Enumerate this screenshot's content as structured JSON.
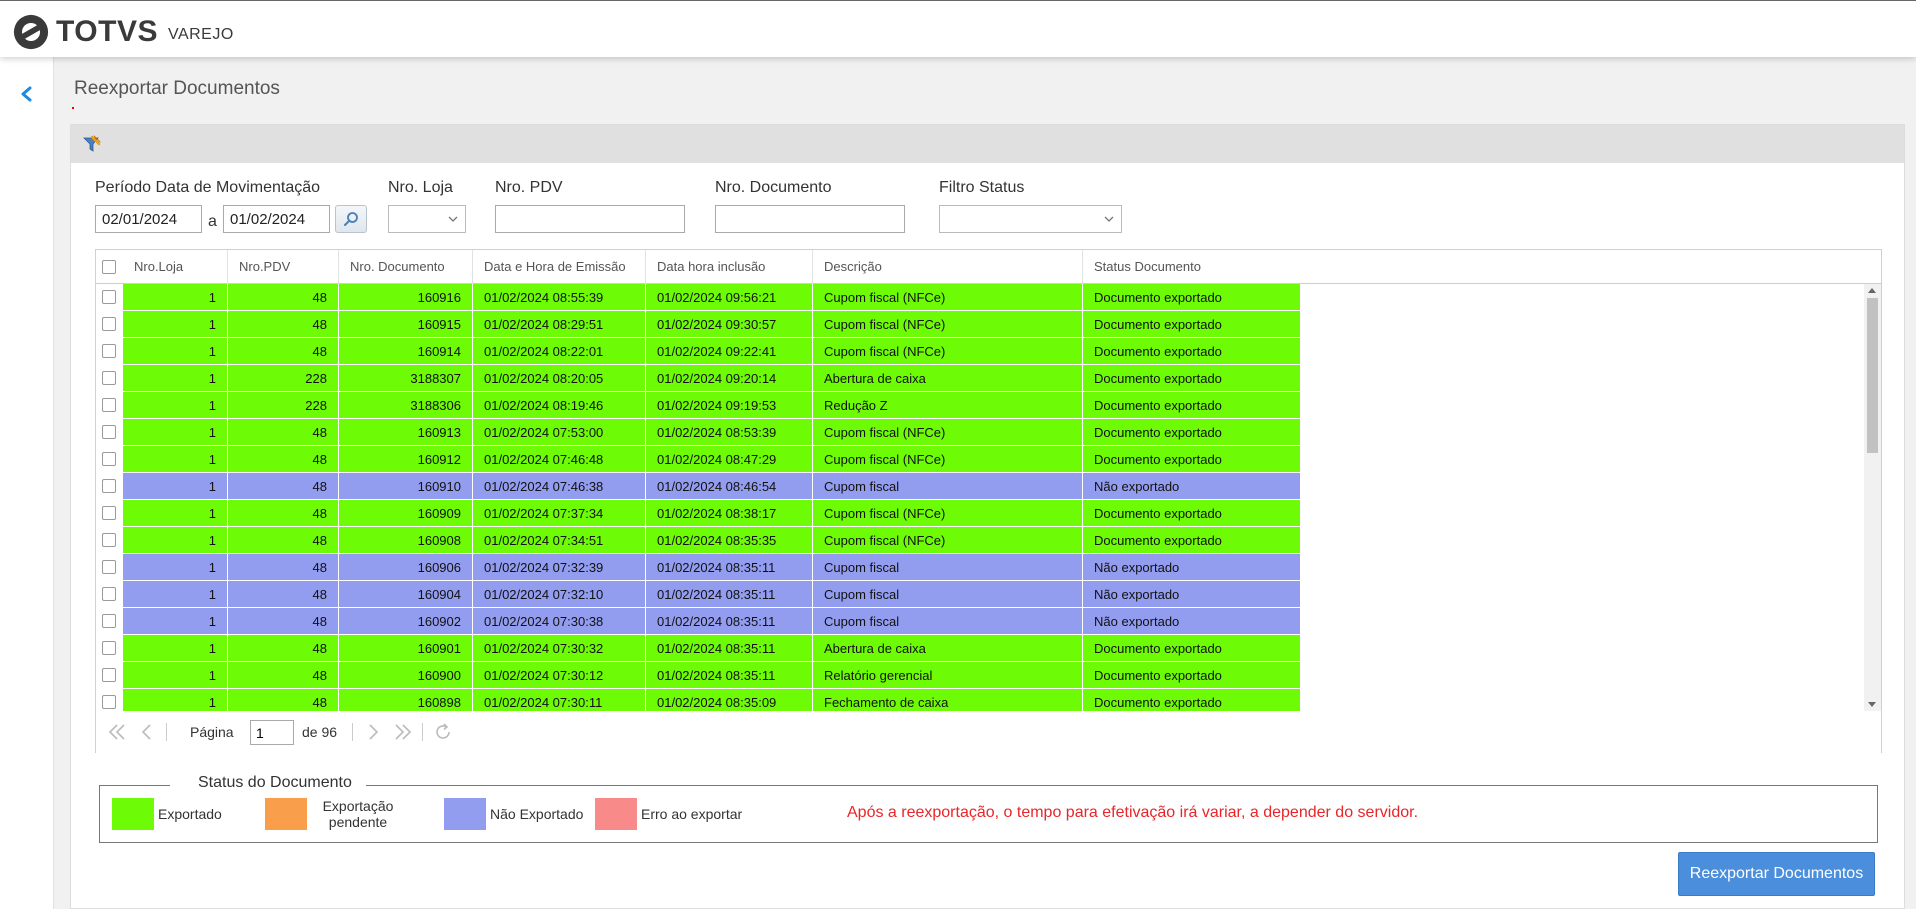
{
  "app": {
    "brand": "TOTVS",
    "subbrand": "VAREJO"
  },
  "page": {
    "title": "Reexportar Documentos"
  },
  "filters": {
    "periodo_label": "Período Data de Movimentação",
    "date_from": "02/01/2024",
    "date_sep": "a",
    "date_to": "01/02/2024",
    "loja_label": "Nro. Loja",
    "loja_value": "",
    "pdv_label": "Nro. PDV",
    "pdv_value": "",
    "documento_label": "Nro. Documento",
    "documento_value": "",
    "status_label": "Filtro Status",
    "status_value": ""
  },
  "grid": {
    "columns": [
      "Nro.Loja",
      "Nro.PDV",
      "Nro. Documento",
      "Data e Hora de Emissão",
      "Data hora inclusão",
      "Descrição",
      "Status Documento"
    ],
    "rows": [
      {
        "loja": "1",
        "pdv": "48",
        "doc": "160916",
        "emissao": "01/02/2024 08:55:39",
        "inclusao": "01/02/2024 09:56:21",
        "descricao": "Cupom fiscal (NFCe)",
        "status": "Documento exportado",
        "state": "exportado"
      },
      {
        "loja": "1",
        "pdv": "48",
        "doc": "160915",
        "emissao": "01/02/2024 08:29:51",
        "inclusao": "01/02/2024 09:30:57",
        "descricao": "Cupom fiscal (NFCe)",
        "status": "Documento exportado",
        "state": "exportado"
      },
      {
        "loja": "1",
        "pdv": "48",
        "doc": "160914",
        "emissao": "01/02/2024 08:22:01",
        "inclusao": "01/02/2024 09:22:41",
        "descricao": "Cupom fiscal (NFCe)",
        "status": "Documento exportado",
        "state": "exportado"
      },
      {
        "loja": "1",
        "pdv": "228",
        "doc": "3188307",
        "emissao": "01/02/2024 08:20:05",
        "inclusao": "01/02/2024 09:20:14",
        "descricao": "Abertura de caixa",
        "status": "Documento exportado",
        "state": "exportado"
      },
      {
        "loja": "1",
        "pdv": "228",
        "doc": "3188306",
        "emissao": "01/02/2024 08:19:46",
        "inclusao": "01/02/2024 09:19:53",
        "descricao": "Redução Z",
        "status": "Documento exportado",
        "state": "exportado"
      },
      {
        "loja": "1",
        "pdv": "48",
        "doc": "160913",
        "emissao": "01/02/2024 07:53:00",
        "inclusao": "01/02/2024 08:53:39",
        "descricao": "Cupom fiscal (NFCe)",
        "status": "Documento exportado",
        "state": "exportado"
      },
      {
        "loja": "1",
        "pdv": "48",
        "doc": "160912",
        "emissao": "01/02/2024 07:46:48",
        "inclusao": "01/02/2024 08:47:29",
        "descricao": "Cupom fiscal (NFCe)",
        "status": "Documento exportado",
        "state": "exportado"
      },
      {
        "loja": "1",
        "pdv": "48",
        "doc": "160910",
        "emissao": "01/02/2024 07:46:38",
        "inclusao": "01/02/2024 08:46:54",
        "descricao": "Cupom fiscal",
        "status": "Não exportado",
        "state": "nao_exportado"
      },
      {
        "loja": "1",
        "pdv": "48",
        "doc": "160909",
        "emissao": "01/02/2024 07:37:34",
        "inclusao": "01/02/2024 08:38:17",
        "descricao": "Cupom fiscal (NFCe)",
        "status": "Documento exportado",
        "state": "exportado"
      },
      {
        "loja": "1",
        "pdv": "48",
        "doc": "160908",
        "emissao": "01/02/2024 07:34:51",
        "inclusao": "01/02/2024 08:35:35",
        "descricao": "Cupom fiscal (NFCe)",
        "status": "Documento exportado",
        "state": "exportado"
      },
      {
        "loja": "1",
        "pdv": "48",
        "doc": "160906",
        "emissao": "01/02/2024 07:32:39",
        "inclusao": "01/02/2024 08:35:11",
        "descricao": "Cupom fiscal",
        "status": "Não exportado",
        "state": "nao_exportado"
      },
      {
        "loja": "1",
        "pdv": "48",
        "doc": "160904",
        "emissao": "01/02/2024 07:32:10",
        "inclusao": "01/02/2024 08:35:11",
        "descricao": "Cupom fiscal",
        "status": "Não exportado",
        "state": "nao_exportado"
      },
      {
        "loja": "1",
        "pdv": "48",
        "doc": "160902",
        "emissao": "01/02/2024 07:30:38",
        "inclusao": "01/02/2024 08:35:11",
        "descricao": "Cupom fiscal",
        "status": "Não exportado",
        "state": "nao_exportado"
      },
      {
        "loja": "1",
        "pdv": "48",
        "doc": "160901",
        "emissao": "01/02/2024 07:30:32",
        "inclusao": "01/02/2024 08:35:11",
        "descricao": "Abertura de caixa",
        "status": "Documento exportado",
        "state": "exportado"
      },
      {
        "loja": "1",
        "pdv": "48",
        "doc": "160900",
        "emissao": "01/02/2024 07:30:12",
        "inclusao": "01/02/2024 08:35:11",
        "descricao": "Relatório gerencial",
        "status": "Documento exportado",
        "state": "exportado"
      },
      {
        "loja": "1",
        "pdv": "48",
        "doc": "160898",
        "emissao": "01/02/2024 07:30:11",
        "inclusao": "01/02/2024 08:35:09",
        "descricao": "Fechamento de caixa",
        "status": "Documento exportado",
        "state": "exportado"
      }
    ]
  },
  "pager": {
    "page_label": "Página",
    "page_value": "1",
    "of_label": "de 96"
  },
  "legend": {
    "title": "Status do Documento",
    "items": [
      {
        "label": "Exportado",
        "color": "#6efb06"
      },
      {
        "label": "Exportação pendente",
        "color": "#f99f4b"
      },
      {
        "label": "Não Exportado",
        "color": "#939df0"
      },
      {
        "label": "Erro ao exportar",
        "color": "#f98a8a"
      }
    ],
    "note": "Após a reexportação, o tempo para efetivação irá variar, a depender do servidor."
  },
  "actions": {
    "reexport_label": "Reexportar Documentos"
  },
  "colors": {
    "exportado": "#6efb06",
    "nao_exportado": "#939df0",
    "accent": "#4a8edc",
    "note_red": "#e8262a"
  }
}
